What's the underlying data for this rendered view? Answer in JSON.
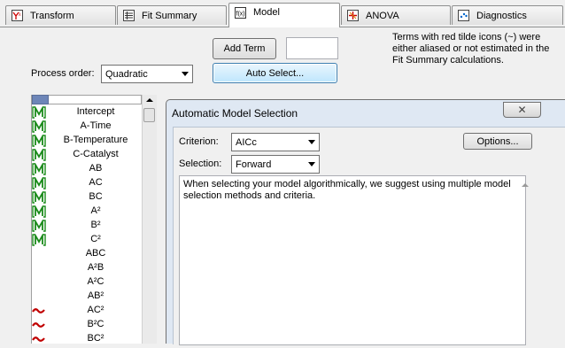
{
  "tabs": [
    {
      "label": "Transform",
      "icon": "transform-icon"
    },
    {
      "label": "Fit Summary",
      "icon": "fit-summary-icon"
    },
    {
      "label": "Model",
      "icon": "model-icon"
    },
    {
      "label": "ANOVA",
      "icon": "anova-icon"
    },
    {
      "label": "Diagnostics",
      "icon": "diagnostics-icon"
    }
  ],
  "controls": {
    "add_term_label": "Add Term",
    "auto_select_label": "Auto Select...",
    "process_order_label": "Process order:",
    "process_order_value": "Quadratic",
    "note": "Terms with red tilde icons (~) were either aliased or not estimated in the Fit Summary calculations."
  },
  "terms": [
    {
      "name": "Intercept",
      "mark": "M"
    },
    {
      "name": "A-Time",
      "mark": "M"
    },
    {
      "name": "B-Temperature",
      "mark": "M"
    },
    {
      "name": "C-Catalyst",
      "mark": "M"
    },
    {
      "name": "AB",
      "mark": "M"
    },
    {
      "name": "AC",
      "mark": "M"
    },
    {
      "name": "BC",
      "mark": "M"
    },
    {
      "name": "A²",
      "mark": "M"
    },
    {
      "name": "B²",
      "mark": "M"
    },
    {
      "name": "C²",
      "mark": "M"
    },
    {
      "name": "ABC",
      "mark": ""
    },
    {
      "name": "A²B",
      "mark": ""
    },
    {
      "name": "A²C",
      "mark": ""
    },
    {
      "name": "AB²",
      "mark": ""
    },
    {
      "name": "AC²",
      "mark": "~"
    },
    {
      "name": "B²C",
      "mark": "~"
    },
    {
      "name": "BC²",
      "mark": "~"
    }
  ],
  "dialog": {
    "title": "Automatic Model Selection",
    "close_label": "✕",
    "criterion_label": "Criterion:",
    "criterion_value": "AICc",
    "selection_label": "Selection:",
    "selection_value": "Forward",
    "options_label": "Options...",
    "description": "When selecting your model algorithmically, we suggest using multiple model selection methods and criteria."
  },
  "colors": {
    "model_mark": "#1a8a1a",
    "tilde_mark": "#c00000",
    "dialog_frame": "#dfe8f3",
    "header_blue": "#6e86b8"
  }
}
